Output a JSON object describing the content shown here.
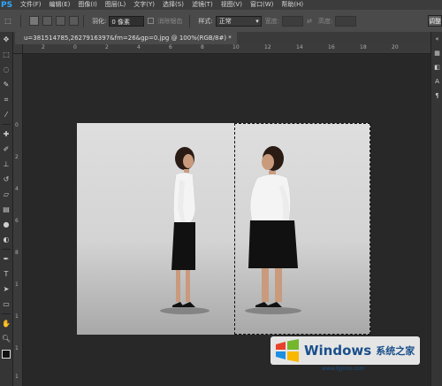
{
  "app": {
    "logo": "PS"
  },
  "menu": [
    "文件(F)",
    "编辑(E)",
    "图像(I)",
    "图层(L)",
    "文字(Y)",
    "选择(S)",
    "滤镜(T)",
    "视图(V)",
    "窗口(W)",
    "帮助(H)"
  ],
  "options": {
    "feather_label": "羽化:",
    "feather_value": "0 像素",
    "antialias_label": "消除锯齿",
    "style_label": "样式:",
    "style_value": "正常",
    "width_label": "宽度:",
    "height_label": "高度:",
    "right_button": "调整"
  },
  "document": {
    "tab_title": "u=381514785,2627916397&fm=26&gp=0.jpg @ 100%(RGB/8#) *"
  },
  "ruler": {
    "top_labels": [
      "2",
      "0",
      "2",
      "4",
      "6",
      "8",
      "10",
      "12",
      "14",
      "16",
      "18",
      "20"
    ],
    "left_labels": [
      "0",
      "2",
      "4",
      "6",
      "8",
      "1",
      "1",
      "1",
      "1"
    ]
  },
  "tools": [
    "move-tool",
    "marquee-tool",
    "lasso-tool",
    "quick-select-tool",
    "crop-tool",
    "eyedropper-tool",
    "healing-tool",
    "brush-tool",
    "clone-stamp-tool",
    "history-brush-tool",
    "eraser-tool",
    "gradient-tool",
    "blur-tool",
    "dodge-tool",
    "pen-tool",
    "type-tool",
    "path-select-tool",
    "shape-tool",
    "hand-tool",
    "zoom-tool"
  ],
  "watermark": {
    "brand": "Windows",
    "suffix": "系统之家",
    "url": "www.bjjmlv.com"
  },
  "colors": {
    "accent": "#2ea8ff",
    "background": "#282828",
    "panel": "#353535"
  }
}
